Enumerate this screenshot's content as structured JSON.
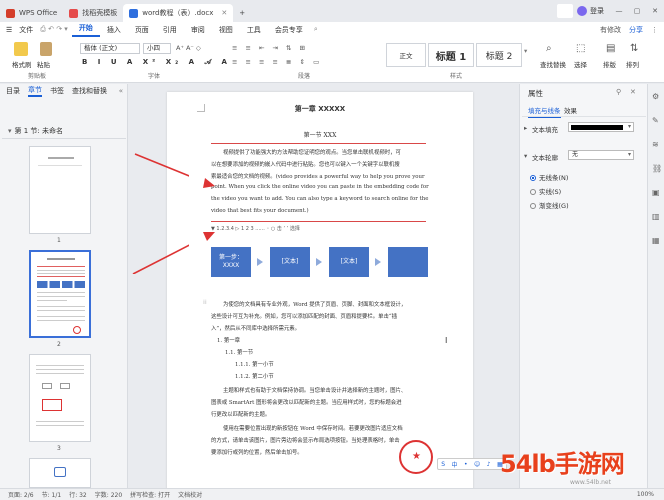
{
  "titlebar": {
    "tabs": [
      {
        "label": "WPS Office",
        "color": "#d43d2a"
      },
      {
        "label": "找稻壳模板",
        "color": "#e54b4b"
      },
      {
        "label": "word教程（表）.docx",
        "color": "#2f6fde"
      }
    ],
    "add": "+",
    "login_label": "登录"
  },
  "menu": {
    "file": "文件",
    "items": [
      "开始",
      "插入",
      "页面",
      "引用",
      "审阅",
      "视图",
      "工具",
      "会员专享"
    ],
    "active": "开始",
    "share": "分享",
    "draft": "有修改"
  },
  "ribbon": {
    "format_painter": "格式刷",
    "paste": "粘贴",
    "clipboard_label": "剪贴板",
    "font_name": "楷体 (正文)",
    "font_size": "小四",
    "font_label": "字体",
    "paragraph_label": "段落",
    "styles": [
      "正文",
      "标题 1",
      "标题 2"
    ],
    "styles_label": "样式",
    "find_replace": "查找替换",
    "select": "选择",
    "layout": "排版",
    "sort": "排列"
  },
  "leftpanel": {
    "tabs": [
      "目录",
      "章节",
      "书签",
      "查找和替换"
    ],
    "active_tab": "章节",
    "section_label": "第 1 节: 未命名",
    "pages": [
      "1",
      "2",
      "3"
    ]
  },
  "document": {
    "chapter_title": "第一章  XXXXX",
    "section_title": "第一节  XXX",
    "para1": [
      "视频提供了功能强大的方法帮助您证明您的观点。当您单击联机视频时，可",
      "以在想要添加的视频的嵌入代码中进行粘贴。您也可以键入一个关键字以联机搜",
      "索最适合您的文档的视频。(video provides a powerful way to help you prove your",
      "point. When you click the online video you can paste in the embedding code for",
      "the video you want to add. You can also type a keyword to search online for the",
      "video that best fits your document.)"
    ],
    "footnote_line": "▼ 1.2.3.4  ▷ 1 2 3 ......  ◦ ○ 击 ‘ ’ 选择",
    "flow": [
      "第一步：\nXXXX",
      "[文本]",
      "[文本]",
      ""
    ],
    "para2": [
      "为使您的文档具有专业外观，Word 提供了页眉、页脚、封面和文本框设计，",
      "这些设计可互为补充。例如，您可以添加匹配的封面、页眉和提要栏。单击“插",
      "入”，然后从不同库中选择所需元素。"
    ],
    "outline": [
      "1. 第一章",
      "1.1. 第一节",
      "1.1.1. 第一小节",
      "1.1.2. 第二小节"
    ],
    "para3": [
      "主题和样式也有助于文档保持协调。当您单击设计并选择新的主题时，图片、",
      "图表或 SmartArt 图形将会更改以匹配新的主题。当应用样式时，您的标题会进",
      "行更改以匹配新的主题。"
    ],
    "para4": [
      "使用在需要位置出现的新按钮在 Word 中保存时间。若要更改图片适应文档",
      "的方式，请单击该图片，图片旁边将会显示布局选项按钮。当处理表格时，单击",
      "要添加行或列的位置，然后单击加号。"
    ]
  },
  "rightpanel": {
    "title": "属性",
    "tabs": [
      "填充与线条",
      "效果"
    ],
    "text_fill_label": "文本填充",
    "text_fill_color": "#000000",
    "text_outline_label": "文本轮廓",
    "text_outline_value": "无",
    "radios": [
      "无线条(N)",
      "实线(S)",
      "渐变线(G)"
    ],
    "selected_radio": 0
  },
  "statusbar": {
    "page": "页面: 2/6",
    "section": "节: 1/1",
    "row": "行: 32",
    "words": "字数: 220",
    "proof": "拼写检查: 打开",
    "doc_status": "文档校对",
    "zoom": "100%"
  },
  "watermark": "54lb手游网",
  "watermark_url": "www.54lb.net"
}
